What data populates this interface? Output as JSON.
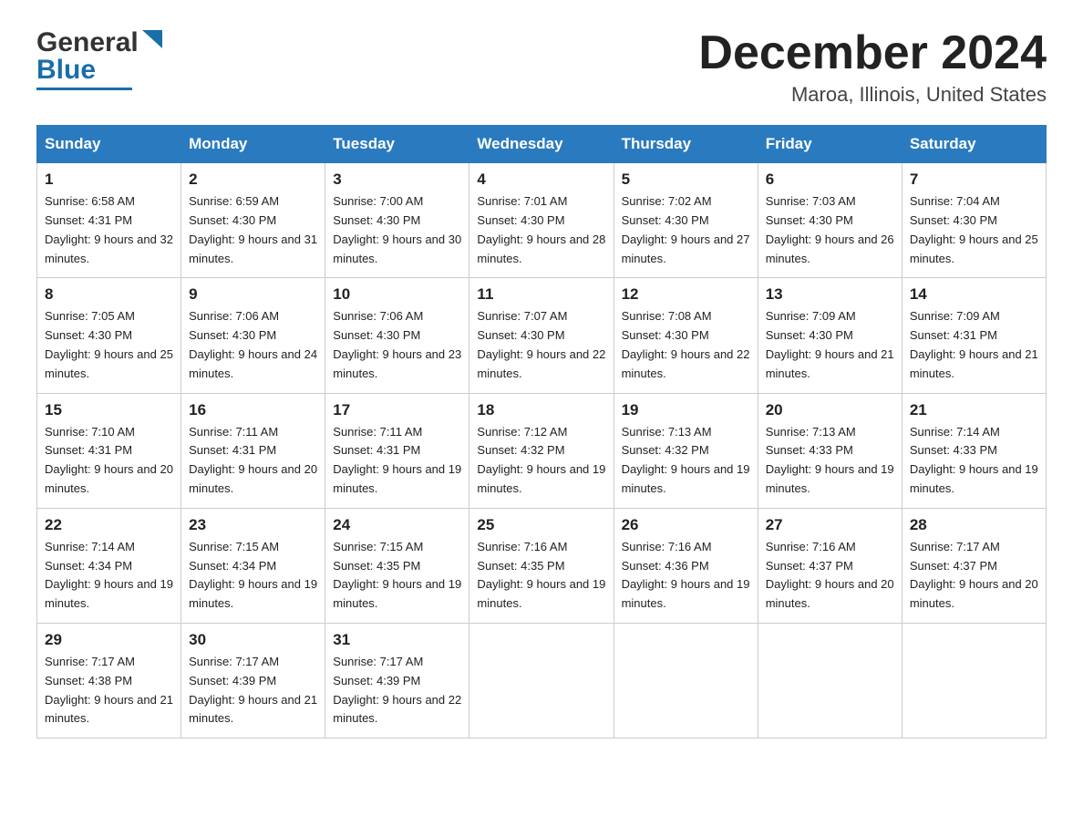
{
  "header": {
    "logo_general": "General",
    "logo_blue": "Blue",
    "month_title": "December 2024",
    "location": "Maroa, Illinois, United States"
  },
  "days_of_week": [
    "Sunday",
    "Monday",
    "Tuesday",
    "Wednesday",
    "Thursday",
    "Friday",
    "Saturday"
  ],
  "weeks": [
    [
      {
        "day": "1",
        "sunrise": "6:58 AM",
        "sunset": "4:31 PM",
        "daylight": "9 hours and 32 minutes."
      },
      {
        "day": "2",
        "sunrise": "6:59 AM",
        "sunset": "4:30 PM",
        "daylight": "9 hours and 31 minutes."
      },
      {
        "day": "3",
        "sunrise": "7:00 AM",
        "sunset": "4:30 PM",
        "daylight": "9 hours and 30 minutes."
      },
      {
        "day": "4",
        "sunrise": "7:01 AM",
        "sunset": "4:30 PM",
        "daylight": "9 hours and 28 minutes."
      },
      {
        "day": "5",
        "sunrise": "7:02 AM",
        "sunset": "4:30 PM",
        "daylight": "9 hours and 27 minutes."
      },
      {
        "day": "6",
        "sunrise": "7:03 AM",
        "sunset": "4:30 PM",
        "daylight": "9 hours and 26 minutes."
      },
      {
        "day": "7",
        "sunrise": "7:04 AM",
        "sunset": "4:30 PM",
        "daylight": "9 hours and 25 minutes."
      }
    ],
    [
      {
        "day": "8",
        "sunrise": "7:05 AM",
        "sunset": "4:30 PM",
        "daylight": "9 hours and 25 minutes."
      },
      {
        "day": "9",
        "sunrise": "7:06 AM",
        "sunset": "4:30 PM",
        "daylight": "9 hours and 24 minutes."
      },
      {
        "day": "10",
        "sunrise": "7:06 AM",
        "sunset": "4:30 PM",
        "daylight": "9 hours and 23 minutes."
      },
      {
        "day": "11",
        "sunrise": "7:07 AM",
        "sunset": "4:30 PM",
        "daylight": "9 hours and 22 minutes."
      },
      {
        "day": "12",
        "sunrise": "7:08 AM",
        "sunset": "4:30 PM",
        "daylight": "9 hours and 22 minutes."
      },
      {
        "day": "13",
        "sunrise": "7:09 AM",
        "sunset": "4:30 PM",
        "daylight": "9 hours and 21 minutes."
      },
      {
        "day": "14",
        "sunrise": "7:09 AM",
        "sunset": "4:31 PM",
        "daylight": "9 hours and 21 minutes."
      }
    ],
    [
      {
        "day": "15",
        "sunrise": "7:10 AM",
        "sunset": "4:31 PM",
        "daylight": "9 hours and 20 minutes."
      },
      {
        "day": "16",
        "sunrise": "7:11 AM",
        "sunset": "4:31 PM",
        "daylight": "9 hours and 20 minutes."
      },
      {
        "day": "17",
        "sunrise": "7:11 AM",
        "sunset": "4:31 PM",
        "daylight": "9 hours and 19 minutes."
      },
      {
        "day": "18",
        "sunrise": "7:12 AM",
        "sunset": "4:32 PM",
        "daylight": "9 hours and 19 minutes."
      },
      {
        "day": "19",
        "sunrise": "7:13 AM",
        "sunset": "4:32 PM",
        "daylight": "9 hours and 19 minutes."
      },
      {
        "day": "20",
        "sunrise": "7:13 AM",
        "sunset": "4:33 PM",
        "daylight": "9 hours and 19 minutes."
      },
      {
        "day": "21",
        "sunrise": "7:14 AM",
        "sunset": "4:33 PM",
        "daylight": "9 hours and 19 minutes."
      }
    ],
    [
      {
        "day": "22",
        "sunrise": "7:14 AM",
        "sunset": "4:34 PM",
        "daylight": "9 hours and 19 minutes."
      },
      {
        "day": "23",
        "sunrise": "7:15 AM",
        "sunset": "4:34 PM",
        "daylight": "9 hours and 19 minutes."
      },
      {
        "day": "24",
        "sunrise": "7:15 AM",
        "sunset": "4:35 PM",
        "daylight": "9 hours and 19 minutes."
      },
      {
        "day": "25",
        "sunrise": "7:16 AM",
        "sunset": "4:35 PM",
        "daylight": "9 hours and 19 minutes."
      },
      {
        "day": "26",
        "sunrise": "7:16 AM",
        "sunset": "4:36 PM",
        "daylight": "9 hours and 19 minutes."
      },
      {
        "day": "27",
        "sunrise": "7:16 AM",
        "sunset": "4:37 PM",
        "daylight": "9 hours and 20 minutes."
      },
      {
        "day": "28",
        "sunrise": "7:17 AM",
        "sunset": "4:37 PM",
        "daylight": "9 hours and 20 minutes."
      }
    ],
    [
      {
        "day": "29",
        "sunrise": "7:17 AM",
        "sunset": "4:38 PM",
        "daylight": "9 hours and 21 minutes."
      },
      {
        "day": "30",
        "sunrise": "7:17 AM",
        "sunset": "4:39 PM",
        "daylight": "9 hours and 21 minutes."
      },
      {
        "day": "31",
        "sunrise": "7:17 AM",
        "sunset": "4:39 PM",
        "daylight": "9 hours and 22 minutes."
      },
      null,
      null,
      null,
      null
    ]
  ]
}
